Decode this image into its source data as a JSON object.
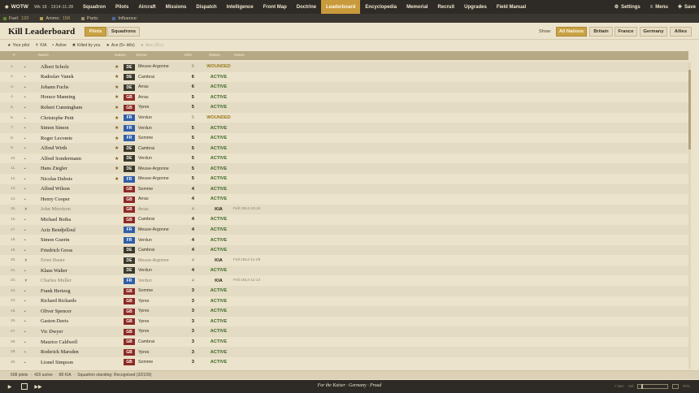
{
  "app": {
    "brand": "WOTW",
    "week_date": "Wk 18 · 1914-11-28"
  },
  "nav": [
    "Squadron",
    "Pilots",
    "Aircraft",
    "Missions",
    "Dispatch",
    "Intelligence",
    "Front Map",
    "Doctrine",
    "Leaderboard",
    "Encyclopedia",
    "Memorial",
    "Recruit",
    "Upgrades",
    "Field Manual"
  ],
  "nav_active": "Leaderboard",
  "top_right": {
    "settings": "Settings",
    "menu": "Menu",
    "save": "Save"
  },
  "resources": [
    {
      "label": "Fuel:",
      "value": "120",
      "color": "#5a8a2c"
    },
    {
      "label": "Ammo:",
      "value": "158",
      "color": "#b8a24a"
    },
    {
      "label": "Parts:",
      "value": "",
      "color": "#9a8d6a"
    },
    {
      "label": "Influence:",
      "value": "",
      "color": "#4a6aa0"
    }
  ],
  "page": {
    "title": "Kill Leaderboard",
    "tabs": [
      "Pilots",
      "Squadrons"
    ],
    "active_tab": "Pilots",
    "show_label": "Show:",
    "filters": [
      "All Nations",
      "Britain",
      "France",
      "Germany",
      "Allies"
    ],
    "active_filter": "All Nations"
  },
  "legend": {
    "your_pilot": "Your pilot",
    "kia": "KIA",
    "active": "Active",
    "killed_by_you": "Killed by you",
    "ace": "Ace (5+ kills)",
    "ace15": "Ace (15+)"
  },
  "columns": {
    "rank": "#",
    "name": "Name",
    "nation": "Nation",
    "sector": "Sector",
    "kills": "Kills",
    "status": "Status",
    "notes": "Notes"
  },
  "rows": [
    {
      "rank": "1.",
      "mark": "•",
      "name": "Albert Scholz",
      "ace": "★",
      "nation": "DE",
      "sector": "Meuse-Argonne",
      "kills": "6",
      "status": "WOUNDED",
      "notes": ""
    },
    {
      "rank": "2.",
      "mark": "•",
      "name": "Radoslav Vanek",
      "ace": "★",
      "nation": "DE",
      "sector": "Cambrai",
      "kills": "6",
      "status": "ACTIVE",
      "notes": ""
    },
    {
      "rank": "3.",
      "mark": "•",
      "name": "Johann Fuchs",
      "ace": "★",
      "nation": "DE",
      "sector": "Arras",
      "kills": "6",
      "status": "ACTIVE",
      "notes": ""
    },
    {
      "rank": "4.",
      "mark": "•",
      "name": "Horace Manning",
      "ace": "★",
      "nation": "GB",
      "sector": "Arras",
      "kills": "5",
      "status": "ACTIVE",
      "notes": ""
    },
    {
      "rank": "5.",
      "mark": "•",
      "name": "Robert Cunningham",
      "ace": "★",
      "nation": "GB",
      "sector": "Ypres",
      "kills": "5",
      "status": "ACTIVE",
      "notes": ""
    },
    {
      "rank": "6.",
      "mark": "•",
      "name": "Christophe Petit",
      "ace": "★",
      "nation": "FR",
      "sector": "Verdun",
      "kills": "5",
      "status": "WOUNDED",
      "notes": ""
    },
    {
      "rank": "7.",
      "mark": "•",
      "name": "Simon Simon",
      "ace": "★",
      "nation": "FR",
      "sector": "Verdun",
      "kills": "5",
      "status": "ACTIVE",
      "notes": ""
    },
    {
      "rank": "8.",
      "mark": "•",
      "name": "Roger Lecomte",
      "ace": "★",
      "nation": "FR",
      "sector": "Somme",
      "kills": "5",
      "status": "ACTIVE",
      "notes": ""
    },
    {
      "rank": "9.",
      "mark": "•",
      "name": "Alfred Wirth",
      "ace": "★",
      "nation": "DE",
      "sector": "Cambrai",
      "kills": "5",
      "status": "ACTIVE",
      "notes": ""
    },
    {
      "rank": "10.",
      "mark": "•",
      "name": "Alfred Sondermann",
      "ace": "★",
      "nation": "DE",
      "sector": "Verdun",
      "kills": "5",
      "status": "ACTIVE",
      "notes": ""
    },
    {
      "rank": "11.",
      "mark": "•",
      "name": "Hans Ziegler",
      "ace": "★",
      "nation": "DE",
      "sector": "Meuse-Argonne",
      "kills": "5",
      "status": "ACTIVE",
      "notes": ""
    },
    {
      "rank": "12.",
      "mark": "•",
      "name": "Nicolas Dubois",
      "ace": "★",
      "nation": "FR",
      "sector": "Meuse-Argonne",
      "kills": "5",
      "status": "ACTIVE",
      "notes": ""
    },
    {
      "rank": "13.",
      "mark": "•",
      "name": "Alfred Wilson",
      "ace": "",
      "nation": "GB",
      "sector": "Somme",
      "kills": "4",
      "status": "ACTIVE",
      "notes": ""
    },
    {
      "rank": "14.",
      "mark": "•",
      "name": "Henry Cooper",
      "ace": "",
      "nation": "GB",
      "sector": "Arras",
      "kills": "4",
      "status": "ACTIVE",
      "notes": ""
    },
    {
      "rank": "15.",
      "mark": "✝",
      "name": "John Morrison",
      "ace": "",
      "nation": "GB",
      "sector": "Arras",
      "kills": "4",
      "status": "KIA",
      "notes": "Fell 1914-10-24"
    },
    {
      "rank": "16.",
      "mark": "•",
      "name": "Michael Botha",
      "ace": "",
      "nation": "GB",
      "sector": "Cambrai",
      "kills": "4",
      "status": "ACTIVE",
      "notes": ""
    },
    {
      "rank": "17.",
      "mark": "•",
      "name": "Aziz Bendjelloul",
      "ace": "",
      "nation": "FR",
      "sector": "Meuse-Argonne",
      "kills": "4",
      "status": "ACTIVE",
      "notes": ""
    },
    {
      "rank": "18.",
      "mark": "•",
      "name": "Simon Guerin",
      "ace": "",
      "nation": "FR",
      "sector": "Verdun",
      "kills": "4",
      "status": "ACTIVE",
      "notes": ""
    },
    {
      "rank": "19.",
      "mark": "•",
      "name": "Friedrich Gross",
      "ace": "",
      "nation": "DE",
      "sector": "Cambrai",
      "kills": "4",
      "status": "ACTIVE",
      "notes": ""
    },
    {
      "rank": "20.",
      "mark": "✝",
      "name": "Ernst Bauer",
      "ace": "",
      "nation": "DE",
      "sector": "Meuse-Argonne",
      "kills": "4",
      "status": "KIA",
      "notes": "Fell 1914-11-28"
    },
    {
      "rank": "21.",
      "mark": "•",
      "name": "Klaus Walter",
      "ace": "",
      "nation": "DE",
      "sector": "Verdun",
      "kills": "4",
      "status": "ACTIVE",
      "notes": ""
    },
    {
      "rank": "22.",
      "mark": "✝",
      "name": "Charles Muller",
      "ace": "",
      "nation": "FR",
      "sector": "Verdun",
      "kills": "4",
      "status": "KIA",
      "notes": "Fell 1914-11-14"
    },
    {
      "rank": "23.",
      "mark": "•",
      "name": "Frank Hertzog",
      "ace": "",
      "nation": "GB",
      "sector": "Somme",
      "kills": "3",
      "status": "ACTIVE",
      "notes": ""
    },
    {
      "rank": "24.",
      "mark": "•",
      "name": "Richard Richards",
      "ace": "",
      "nation": "GB",
      "sector": "Ypres",
      "kills": "3",
      "status": "ACTIVE",
      "notes": ""
    },
    {
      "rank": "25.",
      "mark": "•",
      "name": "Oliver Spencer",
      "ace": "",
      "nation": "GB",
      "sector": "Ypres",
      "kills": "3",
      "status": "ACTIVE",
      "notes": ""
    },
    {
      "rank": "26.",
      "mark": "•",
      "name": "Gaston Davis",
      "ace": "",
      "nation": "GB",
      "sector": "Ypres",
      "kills": "3",
      "status": "ACTIVE",
      "notes": ""
    },
    {
      "rank": "27.",
      "mark": "•",
      "name": "Vic Dwyer",
      "ace": "",
      "nation": "GB",
      "sector": "Ypres",
      "kills": "3",
      "status": "ACTIVE",
      "notes": ""
    },
    {
      "rank": "28.",
      "mark": "•",
      "name": "Maurice Caldwell",
      "ace": "",
      "nation": "GB",
      "sector": "Cambrai",
      "kills": "3",
      "status": "ACTIVE",
      "notes": ""
    },
    {
      "rank": "29.",
      "mark": "•",
      "name": "Roderick Marsden",
      "ace": "",
      "nation": "GB",
      "sector": "Ypres",
      "kills": "3",
      "status": "ACTIVE",
      "notes": ""
    },
    {
      "rank": "30.",
      "mark": "•",
      "name": "Lionel Simpson",
      "ace": "",
      "nation": "GB",
      "sector": "Somme",
      "kills": "3",
      "status": "ACTIVE",
      "notes": ""
    }
  ],
  "status_bar": {
    "pilots": "508 pilots",
    "active": "420 active",
    "kia": "88 KIA",
    "standing": "Squadron standing: Recognised (32/109)",
    "sep": "·"
  },
  "bottom": {
    "motto": "For the Kaiser · Germany · Proud",
    "sec": "< 5ec",
    "vol": "Vol",
    "zoom": "75%"
  }
}
